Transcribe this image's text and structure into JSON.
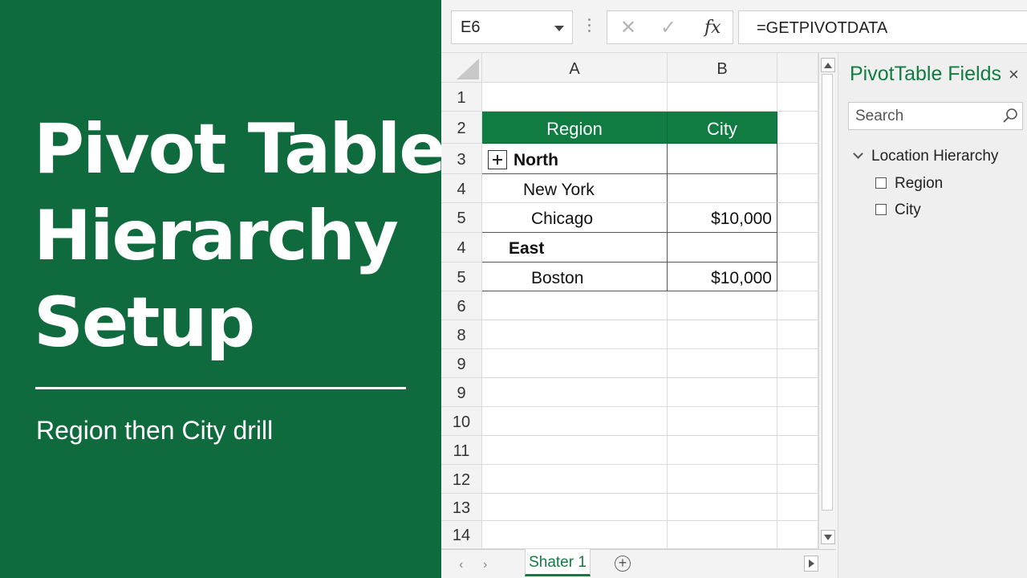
{
  "hero": {
    "title_lines": [
      "Pivot Table",
      "Hierarchy",
      "Setup"
    ],
    "subtitle": "Region then City drill"
  },
  "formula_bar": {
    "name_box": "E6",
    "cancel_symbol": "✕",
    "enter_symbol": "✓",
    "fx_symbol": "fx",
    "formula": "=GETPIVOTDATA"
  },
  "grid": {
    "columns": [
      "A",
      "B"
    ],
    "row_labels": [
      "1",
      "2",
      "3",
      "4",
      "5",
      "4",
      "5",
      "6",
      "8",
      "9",
      "9",
      "10",
      "11",
      "12",
      "13",
      "14"
    ],
    "pivot_headers": {
      "region": "Region",
      "city": "City"
    },
    "pivot_rows": [
      {
        "label": "North",
        "value": ""
      },
      {
        "label": "New York",
        "value": ""
      },
      {
        "label": "Chicago",
        "value": "$10,000"
      },
      {
        "label": "East",
        "value": ""
      },
      {
        "label": "Boston",
        "value": "$10,000"
      }
    ]
  },
  "sheet_tabs": {
    "active": "Shater 1",
    "add_symbol": "+"
  },
  "pivot_pane": {
    "title": "PivotTable Fields",
    "close_symbol": "×",
    "search_placeholder": "Search",
    "hierarchy": "Location Hierarchy",
    "fields": [
      "Region",
      "City"
    ]
  },
  "colors": {
    "brand_green": "#107c41",
    "panel_green": "#0f6b3e"
  },
  "icons": [
    "search-icon",
    "close-icon",
    "chevron-down-icon",
    "expand-plus-icon",
    "add-sheet-icon"
  ]
}
